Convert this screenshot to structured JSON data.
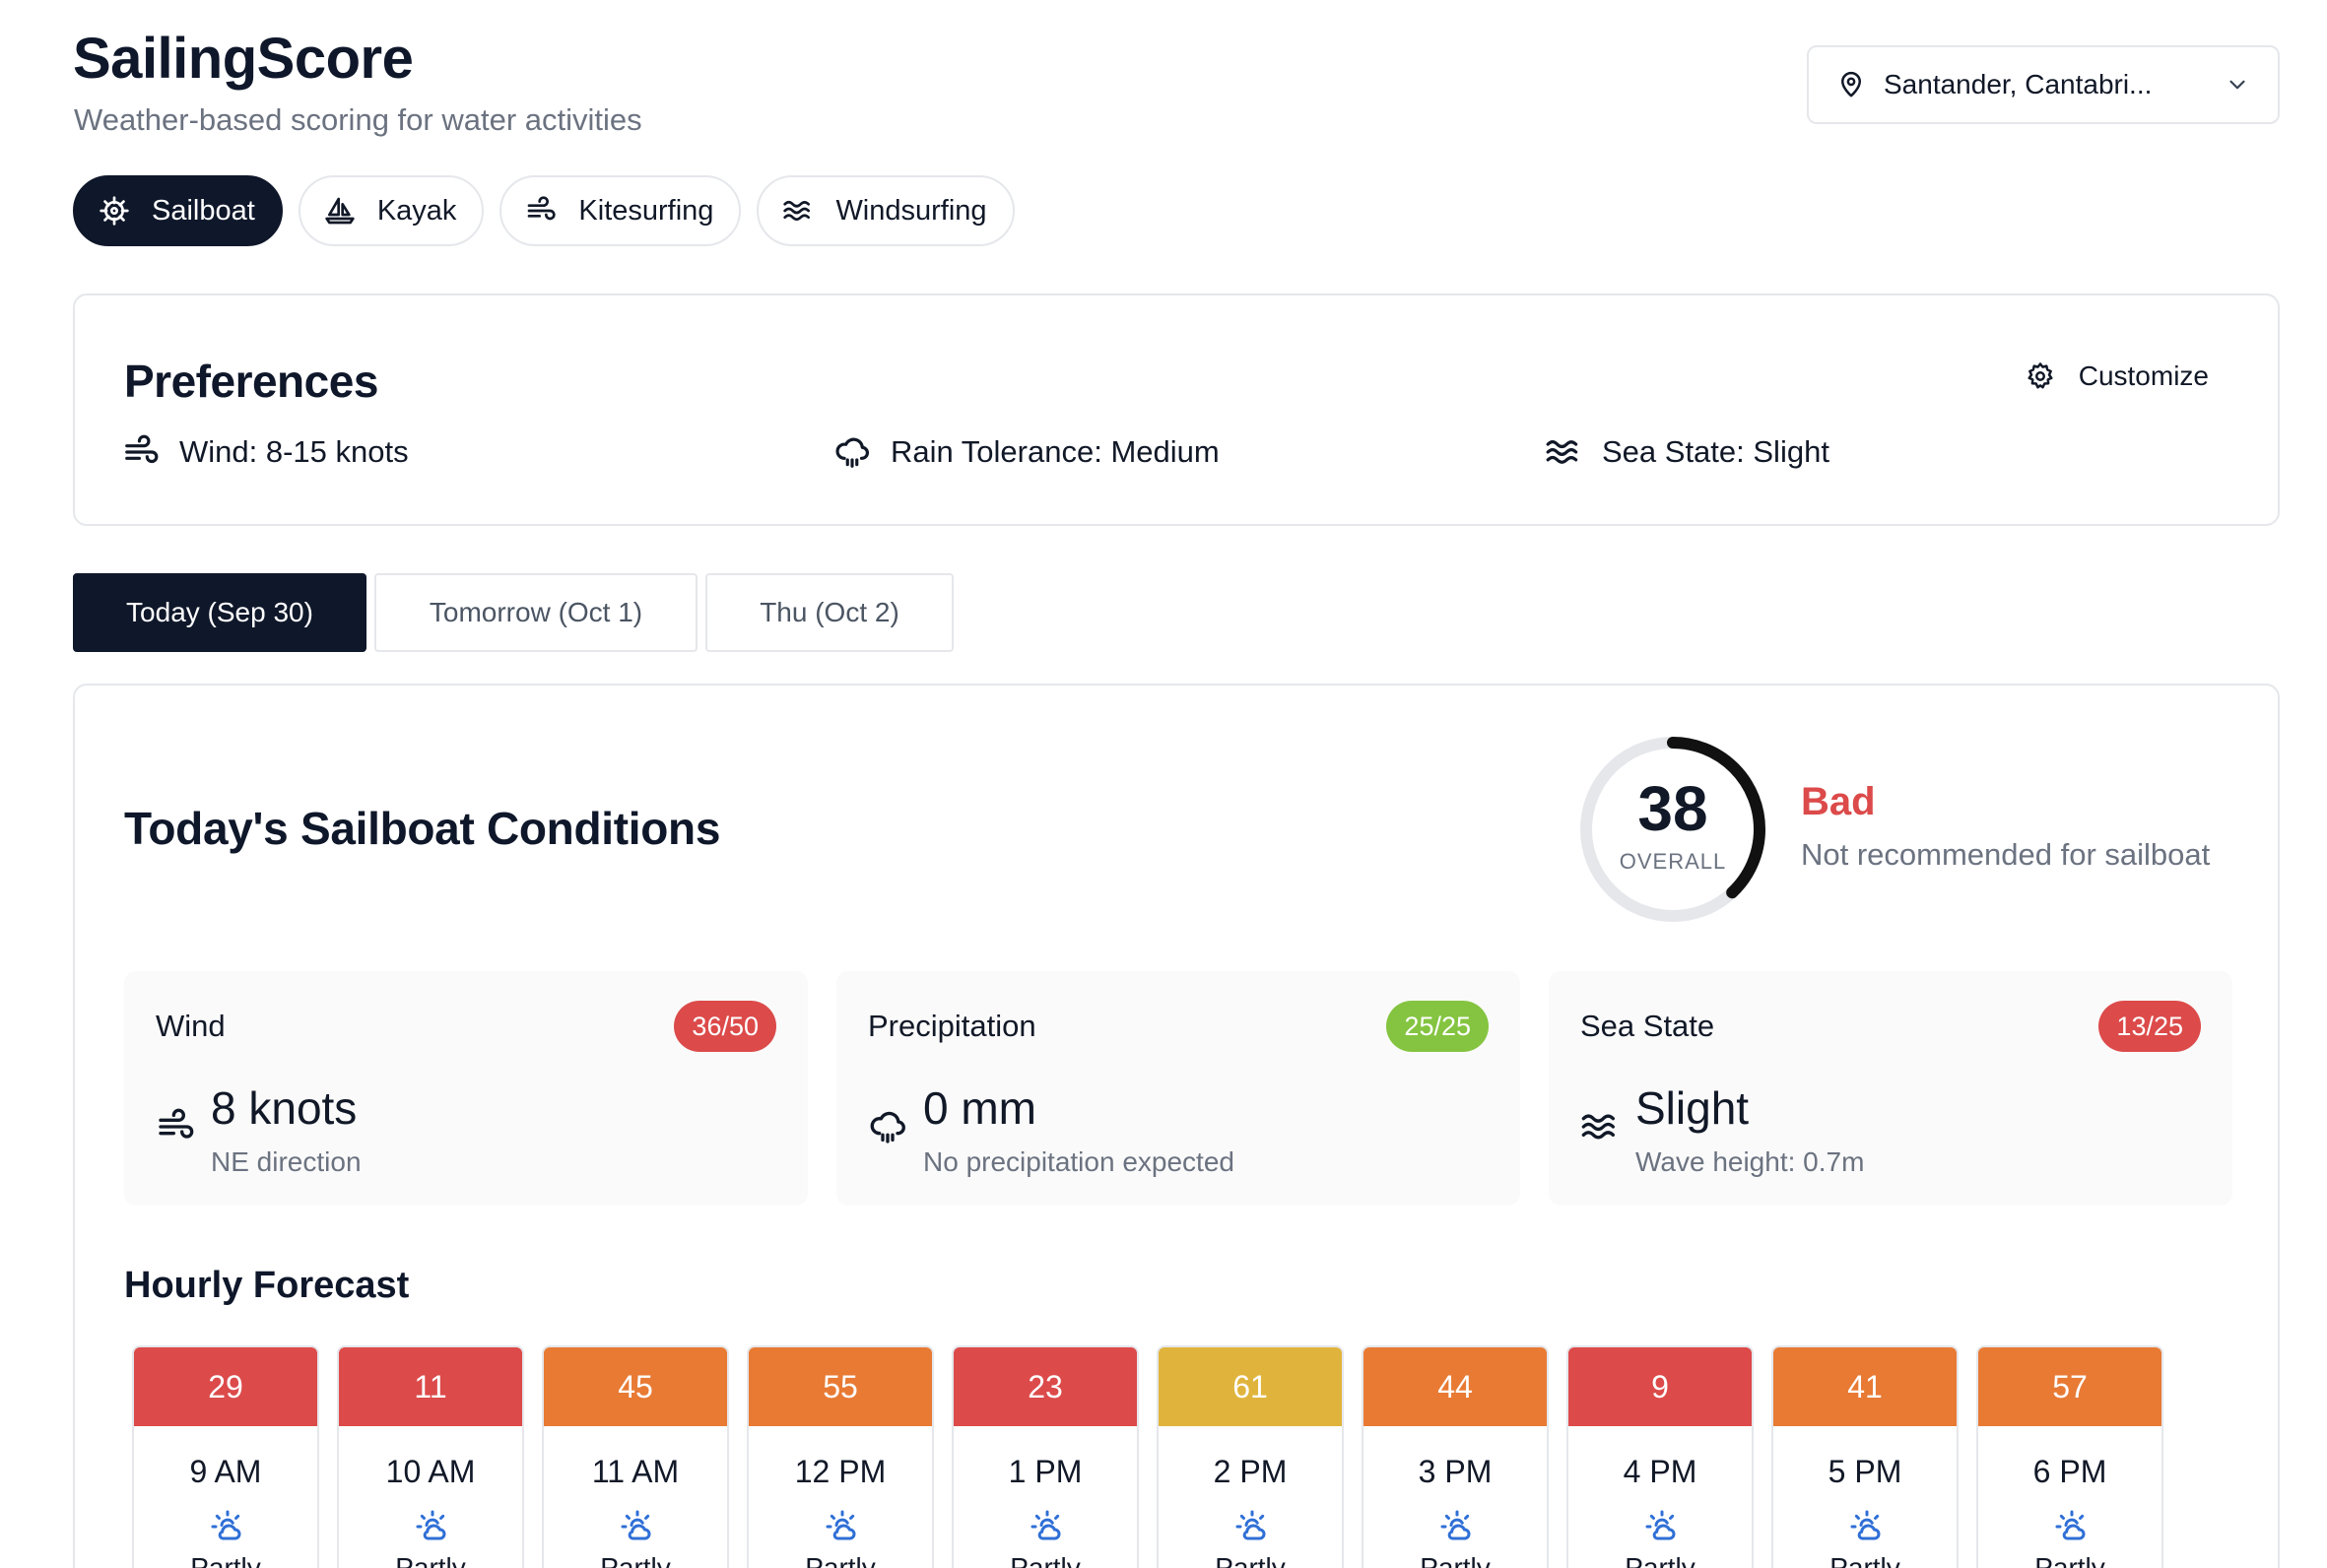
{
  "header": {
    "title": "SailingScore",
    "subtitle": "Weather-based scoring for water activities"
  },
  "location": {
    "value": "Santander, Cantabri...",
    "icon": "map-pin-icon"
  },
  "activities": [
    {
      "label": "Sailboat",
      "icon": "ship-wheel-icon",
      "active": true
    },
    {
      "label": "Kayak",
      "icon": "sailboat-icon",
      "active": false
    },
    {
      "label": "Kitesurfing",
      "icon": "wind-icon",
      "active": false
    },
    {
      "label": "Windsurfing",
      "icon": "waves-icon",
      "active": false
    }
  ],
  "preferences": {
    "title": "Preferences",
    "customize_label": "Customize",
    "wind": "Wind: 8-15 knots",
    "rain": "Rain Tolerance: Medium",
    "sea": "Sea State: Slight"
  },
  "days": [
    {
      "label": "Today (Sep 30)",
      "active": true
    },
    {
      "label": "Tomorrow (Oct 1)",
      "active": false
    },
    {
      "label": "Thu (Oct 2)",
      "active": false
    }
  ],
  "conditions": {
    "title": "Today's Sailboat Conditions",
    "overall_score": "38",
    "overall_label": "OVERALL",
    "overall_fraction": 0.38,
    "rating": "Bad",
    "rating_desc": "Not recommended for sailboat"
  },
  "metrics": {
    "wind": {
      "name": "Wind",
      "badge": "36/50",
      "value": "8 knots",
      "sub": "NE direction"
    },
    "precip": {
      "name": "Precipitation",
      "badge": "25/25",
      "value": "0 mm",
      "sub": "No precipitation expected"
    },
    "sea": {
      "name": "Sea State",
      "badge": "13/25",
      "value": "Slight",
      "sub": "Wave height: 0.7m"
    }
  },
  "hourly": {
    "title": "Hourly Forecast",
    "items": [
      {
        "score": "29",
        "time": "9 AM",
        "cond": "Partly"
      },
      {
        "score": "11",
        "time": "10 AM",
        "cond": "Partly"
      },
      {
        "score": "45",
        "time": "11 AM",
        "cond": "Partly"
      },
      {
        "score": "55",
        "time": "12 PM",
        "cond": "Partly"
      },
      {
        "score": "23",
        "time": "1 PM",
        "cond": "Partly"
      },
      {
        "score": "61",
        "time": "2 PM",
        "cond": "Partly"
      },
      {
        "score": "44",
        "time": "3 PM",
        "cond": "Partly"
      },
      {
        "score": "9",
        "time": "4 PM",
        "cond": "Partly"
      },
      {
        "score": "41",
        "time": "5 PM",
        "cond": "Partly"
      },
      {
        "score": "57",
        "time": "6 PM",
        "cond": "Partly"
      }
    ]
  },
  "colors": {
    "primary": "#0f172a",
    "bad": "#dc4a4a",
    "good": "#84c440",
    "orange": "#e87a34",
    "yellow": "#e0b43c"
  }
}
